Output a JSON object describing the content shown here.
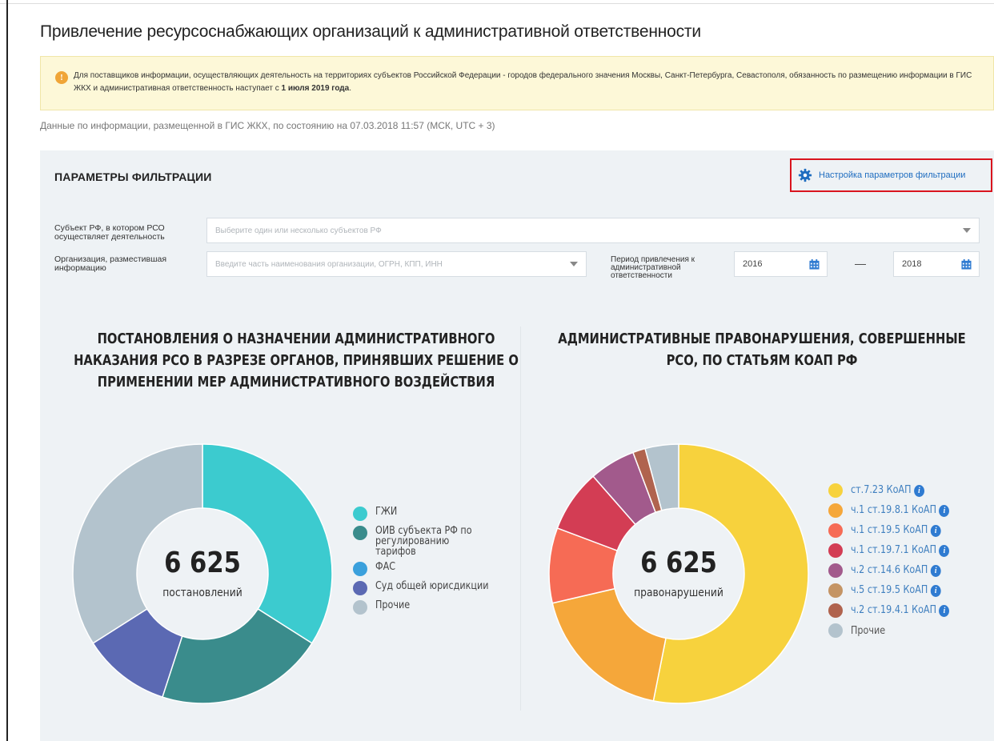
{
  "page": {
    "title": "Привлечение ресурсоснабжающих организаций к административной ответственности",
    "notice_text_1": "Для поставщиков информации, осуществляющих деятельность на территориях субъектов Российской Федерации - городов федерального значения Москвы, Санкт-Петербурга, Севастополя, обязанность по размещению информации в ГИС ЖКХ и административная ответственность наступает с ",
    "notice_bold": "1 июля 2019 года",
    "notice_text_2": ".",
    "data_date": "Данные по информации, размещенной в ГИС ЖКХ, по состоянию на 07.03.2018 11:57 (МСК, UTC + 3)"
  },
  "filters": {
    "title": "ПАРАМЕТРЫ ФИЛЬТРАЦИИ",
    "settings_label": "Настройка параметров фильтрации",
    "subject_label": "Субъект РФ, в котором РСО осуществляет деятельность",
    "subject_placeholder": "Выберите один или несколько субъектов РФ",
    "org_label": "Организация, разместившая информацию",
    "org_placeholder": "Введите часть наименования организации, ОГРН, КПП, ИНН",
    "period_label": "Период привлечения к административной ответственности",
    "period_from": "2016",
    "period_dash": "—",
    "period_to": "2018"
  },
  "chart_data": [
    {
      "type": "pie",
      "title": "ПОСТАНОВЛЕНИЯ О НАЗНАЧЕНИИ АДМИНИСТРАТИВНОГО НАКАЗАНИЯ РСО В РАЗРЕЗЕ ОРГАНОВ, ПРИНЯВШИХ РЕШЕНИЕ О ПРИМЕНЕНИИ МЕР АДМИНИСТРАТИВНОГО ВОЗДЕЙСТВИЯ",
      "total": "6 625",
      "total_caption": "постановлений",
      "categories": [
        "ГЖИ",
        "ОИВ субъекта РФ по регулированию тарифов",
        "ФАС",
        "Суд общей юрисдикции",
        "Прочие"
      ],
      "values": [
        34,
        21,
        0,
        11,
        34
      ],
      "colors": [
        "#3ccbcf",
        "#3a8c8c",
        "#3aa0dc",
        "#5b69b3",
        "#b3c3cd"
      ],
      "legend": "right"
    },
    {
      "type": "pie",
      "title": "АДМИНИСТРАТИВНЫЕ ПРАВОНАРУШЕНИЯ, СОВЕРШЕННЫЕ РСО, ПО СТАТЬЯМ КОАП РФ",
      "total": "6 625",
      "total_caption": "правонарушений",
      "categories": [
        "ст.7.23 КоАП",
        "ч.1 ст.19.8.1 КоАП",
        "ч.1 ст.19.5 КоАП",
        "ч.1 ст.19.7.1 КоАП",
        "ч.2 ст.14.6 КоАП",
        "ч.5 ст.19.5 КоАП",
        "ч.2 ст.19.4.1 КоАП",
        "Прочие"
      ],
      "values": [
        51,
        17.5,
        9,
        7.5,
        5.5,
        0,
        1.5,
        4
      ],
      "colors": [
        "#f7d23d",
        "#f5a73a",
        "#f66b55",
        "#d33d54",
        "#a25a8c",
        "#c49464",
        "#b0634e",
        "#b3c3cd"
      ],
      "legend": "right"
    }
  ]
}
